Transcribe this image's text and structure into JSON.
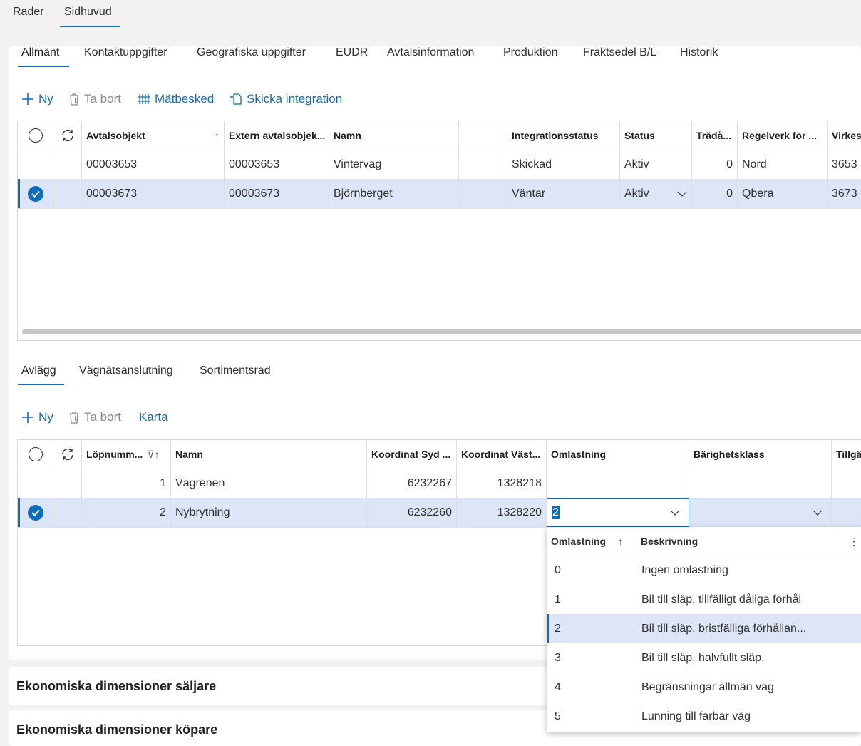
{
  "top_tabs": [
    "Rader",
    "Sidhuvud"
  ],
  "header_tabs": [
    "Allmänt",
    "Kontaktuppgifter",
    "Geografiska uppgifter",
    "EUDR",
    "Avtalsinformation",
    "Produktion",
    "Fraktsedel B/L",
    "Historik"
  ],
  "toolbar1": {
    "new": "Ny",
    "delete": "Ta bort",
    "measure": "Mätbesked",
    "send": "Skicka integration"
  },
  "grid1": {
    "headers": [
      "Avtalsobjekt",
      "Extern avtalsobjek...",
      "Namn",
      "",
      "Integrationsstatus",
      "Status",
      "Trädå...",
      "Regelverk för ...",
      "Virkes"
    ],
    "rows": [
      [
        "00003653",
        "00003653",
        "Vinterväg",
        "",
        "Skickad",
        "Aktiv",
        "0",
        "Nord",
        "3653"
      ],
      [
        "00003673",
        "00003673",
        "Björnberget",
        "",
        "Väntar",
        "Aktiv",
        "0",
        "Qbera",
        "3673"
      ]
    ]
  },
  "sub_tabs": [
    "Avlägg",
    "Vägnätsanslutning",
    "Sortimentsrad"
  ],
  "toolbar2": {
    "new": "Ny",
    "delete": "Ta bort",
    "map": "Karta"
  },
  "grid2": {
    "headers": [
      "Löpnumm...",
      "Namn",
      "Koordinat Syd ...",
      "Koordinat Väst...",
      "Omlastning",
      "Bärighetsklass",
      "Tillgä"
    ],
    "rows": [
      [
        "1",
        "Vägrenen",
        "6232267",
        "1328218",
        "",
        "",
        ""
      ],
      [
        "2",
        "Nybrytning",
        "6232260",
        "1328220",
        "2",
        "",
        ""
      ]
    ]
  },
  "dropdown": {
    "headers": [
      "Omlastning",
      "Beskrivning"
    ],
    "options": [
      {
        "code": "0",
        "desc": "Ingen omlastning"
      },
      {
        "code": "1",
        "desc": "Bil till släp, tillfälligt dåliga förhål"
      },
      {
        "code": "2",
        "desc": "Bil till släp, bristfälliga förhållan..."
      },
      {
        "code": "3",
        "desc": "Bil till släp, halvfullt släp."
      },
      {
        "code": "4",
        "desc": "Begränsningar allmän väg"
      },
      {
        "code": "5",
        "desc": "Lunning till farbar väg"
      }
    ]
  },
  "sections": [
    "Ekonomiska dimensioner säljare",
    "Ekonomiska dimensioner köpare"
  ],
  "colors": {
    "accent": "#0f6cbd",
    "selected_row": "#dce6f7"
  }
}
